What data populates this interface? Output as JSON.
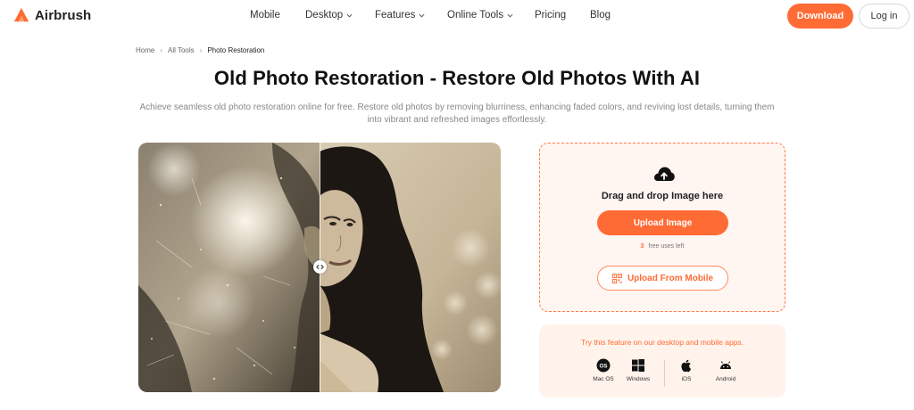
{
  "brand": {
    "name": "Airbrush",
    "accent": "#ff6b35"
  },
  "nav": {
    "items": [
      {
        "label": "Mobile",
        "has_dropdown": false
      },
      {
        "label": "Desktop",
        "has_dropdown": true
      },
      {
        "label": "Features",
        "has_dropdown": true
      },
      {
        "label": "Online Tools",
        "has_dropdown": true
      },
      {
        "label": "Pricing",
        "has_dropdown": false
      },
      {
        "label": "Blog",
        "has_dropdown": false
      }
    ],
    "download_label": "Download",
    "login_label": "Log in"
  },
  "breadcrumb": {
    "items": [
      "Home",
      "All Tools",
      "Photo Restoration"
    ]
  },
  "page": {
    "title": "Old Photo Restoration - Restore Old Photos With AI",
    "subtitle": "Achieve seamless old photo restoration online for free. Restore old photos by removing blurriness, enhancing faded colors, and reviving lost details, turning them into vibrant and refreshed images effortlessly."
  },
  "compare": {
    "slider_position": 0.5
  },
  "upload": {
    "drop_text": "Drag and drop Image here",
    "upload_button": "Upload Image",
    "uses_count": "3",
    "uses_text": "free uses left",
    "mobile_button": "Upload From Mobile",
    "icons": [
      "cloud-upload-icon",
      "qr-code-icon"
    ]
  },
  "apps": {
    "title": "Try this feature on our desktop and mobile apps.",
    "items": [
      {
        "label": "Mac OS",
        "icon": "macos-icon"
      },
      {
        "label": "Windows",
        "icon": "windows-icon"
      },
      {
        "label": "iOS",
        "icon": "apple-icon"
      },
      {
        "label": "Android",
        "icon": "android-icon"
      }
    ]
  }
}
